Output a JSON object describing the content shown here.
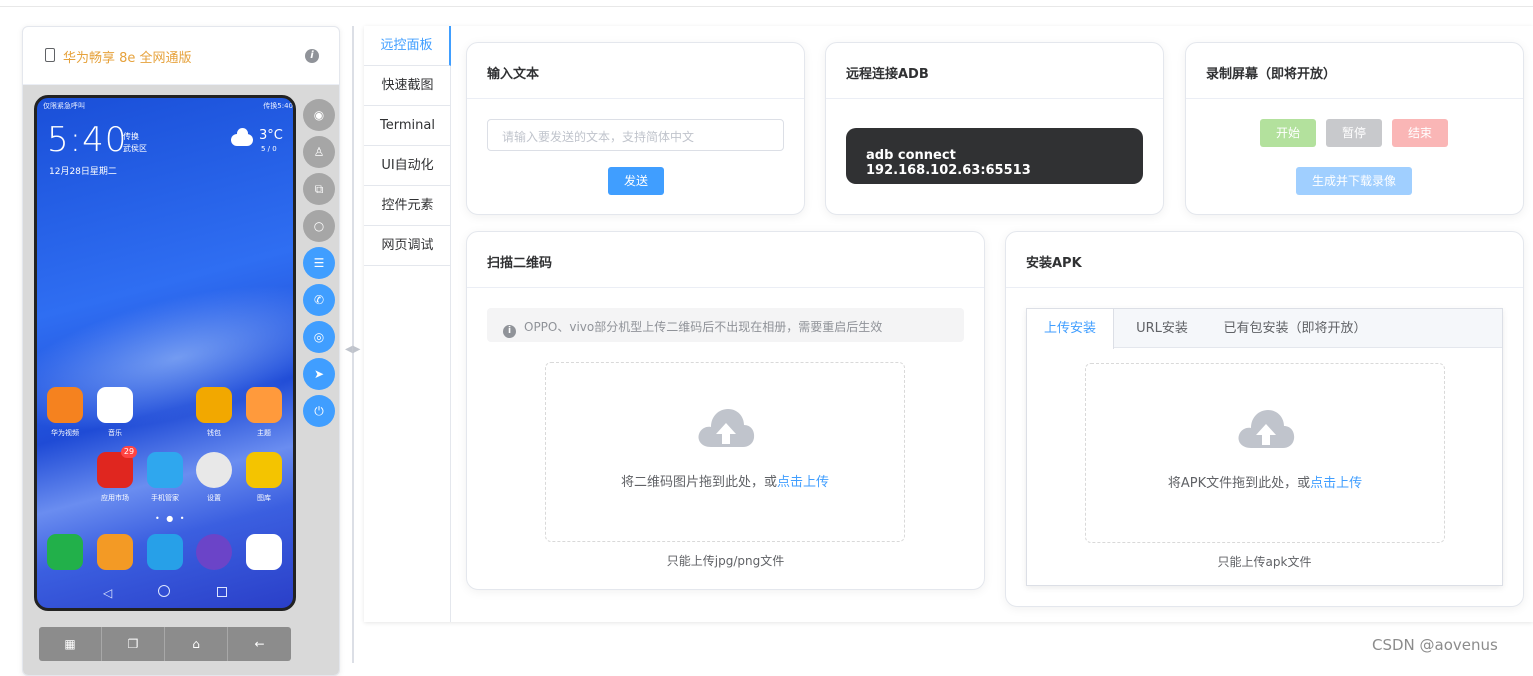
{
  "device": {
    "name": "华为畅享 8e 全网通版",
    "screen": {
      "status_left": "仅限紧急呼叫",
      "status_right": "传换5:40",
      "time": "5:40",
      "location_line1": "传换",
      "location_line2": "武侯区",
      "date": "12月28日星期二",
      "temperature": "3°C",
      "temp_range": "5 / 0",
      "apps": [
        {
          "label": "华为视频",
          "color": "#f5821f"
        },
        {
          "label": "音乐",
          "color": "#ffffff"
        },
        {
          "label": "钱包",
          "color": "#f2a800"
        },
        {
          "label": "主题",
          "color": "#ff9a3c"
        },
        {
          "label": "应用市场",
          "color": "#e0261f",
          "badge": "29"
        },
        {
          "label": "手机管家",
          "color": "#2fa7ee"
        },
        {
          "label": "设置",
          "color": "#e8e8e8"
        },
        {
          "label": "图库",
          "color": "#f4c400"
        }
      ],
      "dock": [
        {
          "name": "phone",
          "color": "#22b04a"
        },
        {
          "name": "contacts",
          "color": "#f39a25"
        },
        {
          "name": "messages",
          "color": "#27a0e8"
        },
        {
          "name": "browser",
          "color": "#6b44c8"
        },
        {
          "name": "camera",
          "color": "#ffffff"
        }
      ],
      "page_dots": "• ● •"
    },
    "side_buttons": [
      {
        "icon": "eye-icon",
        "glyph": "◉",
        "style": "gray"
      },
      {
        "icon": "user-icon",
        "glyph": "♙",
        "style": "gray"
      },
      {
        "icon": "copy-icon",
        "glyph": "⧉",
        "style": "gray"
      },
      {
        "icon": "search-icon",
        "glyph": "○",
        "style": "gray"
      },
      {
        "icon": "sliders-icon",
        "glyph": "☰",
        "style": "blue"
      },
      {
        "icon": "phone-icon",
        "glyph": "✆",
        "style": "blue"
      },
      {
        "icon": "camera-icon",
        "glyph": "◎",
        "style": "blue"
      },
      {
        "icon": "send-icon",
        "glyph": "➤",
        "style": "blue"
      },
      {
        "icon": "power-icon",
        "glyph": "⏻",
        "style": "blue"
      }
    ],
    "bottom_buttons": [
      {
        "icon": "grid-icon",
        "glyph": "▦"
      },
      {
        "icon": "windows-icon",
        "glyph": "❐"
      },
      {
        "icon": "home-icon",
        "glyph": "⌂"
      },
      {
        "icon": "back-icon",
        "glyph": "←"
      }
    ]
  },
  "tabs": [
    "远控面板",
    "快速截图",
    "Terminal",
    "UI自动化",
    "控件元素",
    "网页调试"
  ],
  "active_tab": 0,
  "input_card": {
    "title": "输入文本",
    "placeholder": "请输入要发送的文本，支持简体中文",
    "send_label": "发送"
  },
  "adb_card": {
    "title": "远程连接ADB",
    "command": "adb connect 192.168.102.63:65513"
  },
  "record_card": {
    "title": "录制屏幕（即将开放）",
    "start": "开始",
    "pause": "暂停",
    "end": "结束",
    "generate": "生成并下载录像"
  },
  "qr_card": {
    "title": "扫描二维码",
    "tip": "OPPO、vivo部分机型上传二维码后不出现在相册，需要重启后生效",
    "drop_text": "将二维码图片拖到此处，或",
    "drop_link": "点击上传",
    "format_tip": "只能上传jpg/png文件"
  },
  "apk_card": {
    "title": "安装APK",
    "tabs": [
      "上传安装",
      "URL安装",
      "已有包安装（即将开放）"
    ],
    "drop_text": "将APK文件拖到此处，或",
    "drop_link": "点击上传",
    "format_tip": "只能上传apk文件"
  },
  "watermark": "CSDN @aovenus",
  "colors": {
    "primary": "#409eff",
    "warning": "#e6a23c",
    "dark": "#303133"
  }
}
